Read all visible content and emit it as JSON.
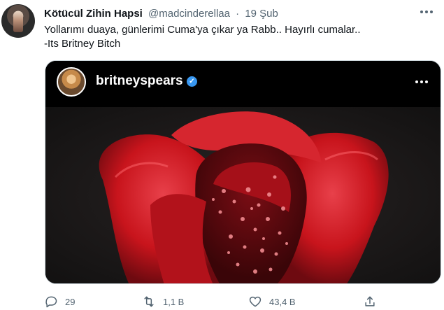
{
  "tweet": {
    "author_name": "Kötücül Zihin Hapsi",
    "handle": "@madcinderellaa",
    "separator": "·",
    "date": "19 Şub",
    "text_lines": [
      "Yollarımı duaya, günlerimi Cuma'ya çıkar ya Rabb.. Hayırlı cumalar..",
      "-Its Britney Bitch"
    ]
  },
  "media": {
    "ig_username": "britneyspears",
    "verified_mark": "✓",
    "photo_subject": "red rose with water droplets"
  },
  "actions": {
    "reply_count": "29",
    "retweet_count": "1,1 B",
    "like_count": "43,4 B"
  },
  "icons": {
    "reply": "reply-icon",
    "retweet": "retweet-icon",
    "like": "heart-icon",
    "share": "share-icon",
    "more": "more-icon"
  },
  "colors": {
    "text": "#0f1419",
    "muted": "#536471",
    "rose_red": "#c8141c",
    "verified_blue": "#3897f0"
  }
}
